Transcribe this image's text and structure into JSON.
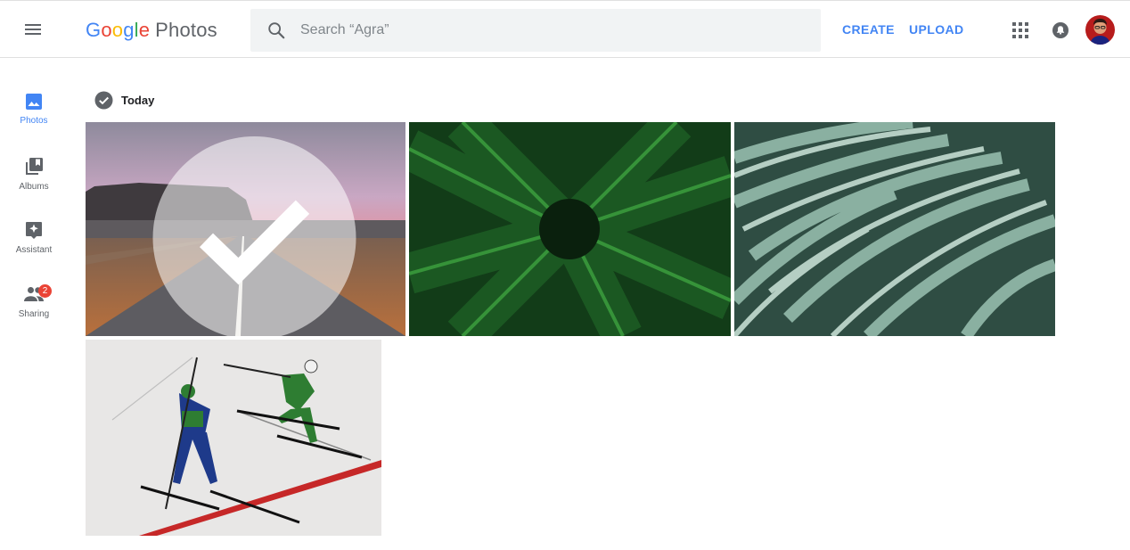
{
  "app": {
    "logo_letters": [
      "G",
      "o",
      "o",
      "g",
      "l",
      "e"
    ],
    "product_name": "Photos"
  },
  "search": {
    "placeholder": "Search “Agra”"
  },
  "header": {
    "create_label": "CREATE",
    "upload_label": "UPLOAD"
  },
  "sidebar": {
    "items": [
      {
        "label": "Photos",
        "icon": "photo-icon",
        "active": true
      },
      {
        "label": "Albums",
        "icon": "albums-icon",
        "active": false
      },
      {
        "label": "Assistant",
        "icon": "assistant-icon",
        "active": false
      },
      {
        "label": "Sharing",
        "icon": "sharing-icon",
        "active": false,
        "badge": "2"
      }
    ]
  },
  "main": {
    "section_title": "Today",
    "photos": [
      {
        "subject": "road-sunset"
      },
      {
        "subject": "fern"
      },
      {
        "subject": "grass"
      },
      {
        "subject": "skiers"
      }
    ]
  },
  "colors": {
    "accent": "#4285f4",
    "badge": "#ea4335",
    "search_bg": "#f1f3f4"
  }
}
